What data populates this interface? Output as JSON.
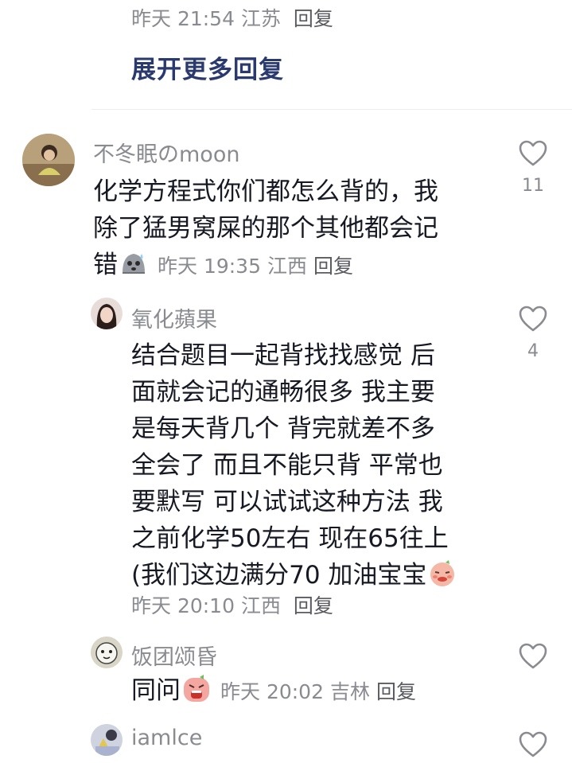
{
  "top_reply": {
    "time": "昨天 21:54",
    "location": "江苏",
    "reply_label": "回复"
  },
  "expand_more_label": "展开更多回复",
  "comments": [
    {
      "username": "不冬眠のmoon",
      "lines": [
        "化学方程式你们都怎么背的，我",
        "除了猛男窝屎的那个其他都会记",
        "错"
      ],
      "emoji": "sweat-blob-emoji",
      "time": "昨天 19:35",
      "location": "江西",
      "reply_label": "回复",
      "likes": "11"
    },
    {
      "username": "氧化蘋果",
      "lines": [
        "结合题目一起背找找感觉 后",
        "面就会记的通畅很多 我主要",
        "是每天背几个 背完就差不多",
        "全会了 而且不能只背 平常也",
        "要默写 可以试试这种方法 我",
        "之前化学50左右 现在65往上",
        "(我们这边满分70 加油宝宝"
      ],
      "emoji": "blush-emoji",
      "time": "昨天 20:10",
      "location": "江西",
      "reply_label": "回复",
      "likes": "4"
    },
    {
      "username": "饭团颂昏",
      "text": "同问",
      "emoji": "crying-emoji",
      "time": "昨天 20:02",
      "location": "吉林",
      "reply_label": "回复"
    },
    {
      "username": "iamlce"
    }
  ],
  "colors": {
    "text": "#161823",
    "muted": "#8a8b91",
    "expand_link": "#2a3a6e"
  }
}
